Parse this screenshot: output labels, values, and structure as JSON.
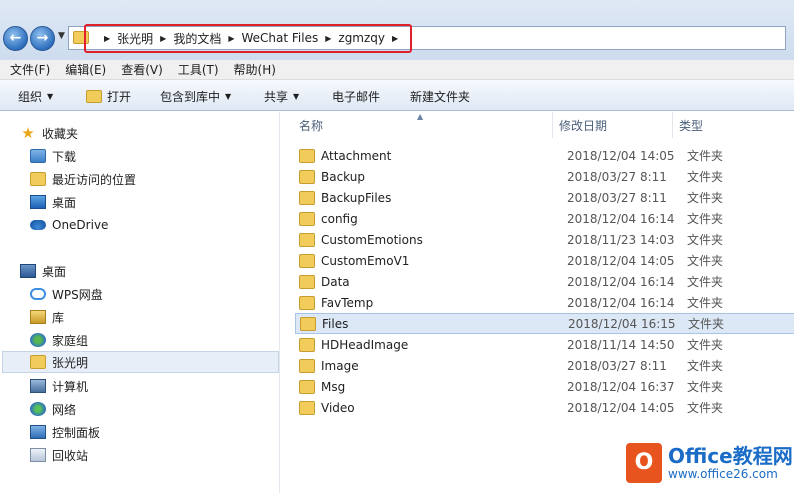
{
  "address": {
    "crumbs": [
      "张光明",
      "我的文档",
      "WeChat Files",
      "zgmzqy"
    ]
  },
  "menu": [
    "文件(F)",
    "编辑(E)",
    "查看(V)",
    "工具(T)",
    "帮助(H)"
  ],
  "toolbar": {
    "organize": "组织",
    "open": "打开",
    "include": "包含到库中",
    "share": "共享",
    "email": "电子邮件",
    "new_folder": "新建文件夹"
  },
  "sidebar": {
    "favorites": "收藏夹",
    "downloads": "下载",
    "recent": "最近访问的位置",
    "desktop_fav": "桌面",
    "onedrive": "OneDrive",
    "desktop": "桌面",
    "wps": "WPS网盘",
    "library": "库",
    "homegroup": "家庭组",
    "user": "张光明",
    "computer": "计算机",
    "network": "网络",
    "control_panel": "控制面板",
    "recycle": "回收站"
  },
  "columns": {
    "name": "名称",
    "date": "修改日期",
    "type": "类型"
  },
  "files": [
    {
      "name": "Attachment",
      "date": "2018/12/04 14:05",
      "type": "文件夹"
    },
    {
      "name": "Backup",
      "date": "2018/03/27 8:11",
      "type": "文件夹"
    },
    {
      "name": "BackupFiles",
      "date": "2018/03/27 8:11",
      "type": "文件夹"
    },
    {
      "name": "config",
      "date": "2018/12/04 16:14",
      "type": "文件夹"
    },
    {
      "name": "CustomEmotions",
      "date": "2018/11/23 14:03",
      "type": "文件夹"
    },
    {
      "name": "CustomEmoV1",
      "date": "2018/12/04 14:05",
      "type": "文件夹"
    },
    {
      "name": "Data",
      "date": "2018/12/04 16:14",
      "type": "文件夹"
    },
    {
      "name": "FavTemp",
      "date": "2018/12/04 16:14",
      "type": "文件夹"
    },
    {
      "name": "Files",
      "date": "2018/12/04 16:15",
      "type": "文件夹"
    },
    {
      "name": "HDHeadImage",
      "date": "2018/11/14 14:50",
      "type": "文件夹"
    },
    {
      "name": "Image",
      "date": "2018/03/27 8:11",
      "type": "文件夹"
    },
    {
      "name": "Msg",
      "date": "2018/12/04 16:37",
      "type": "文件夹"
    },
    {
      "name": "Video",
      "date": "2018/12/04 14:05",
      "type": "文件夹"
    }
  ],
  "watermark": {
    "title": "Office教程网",
    "url": "www.office26.com"
  }
}
